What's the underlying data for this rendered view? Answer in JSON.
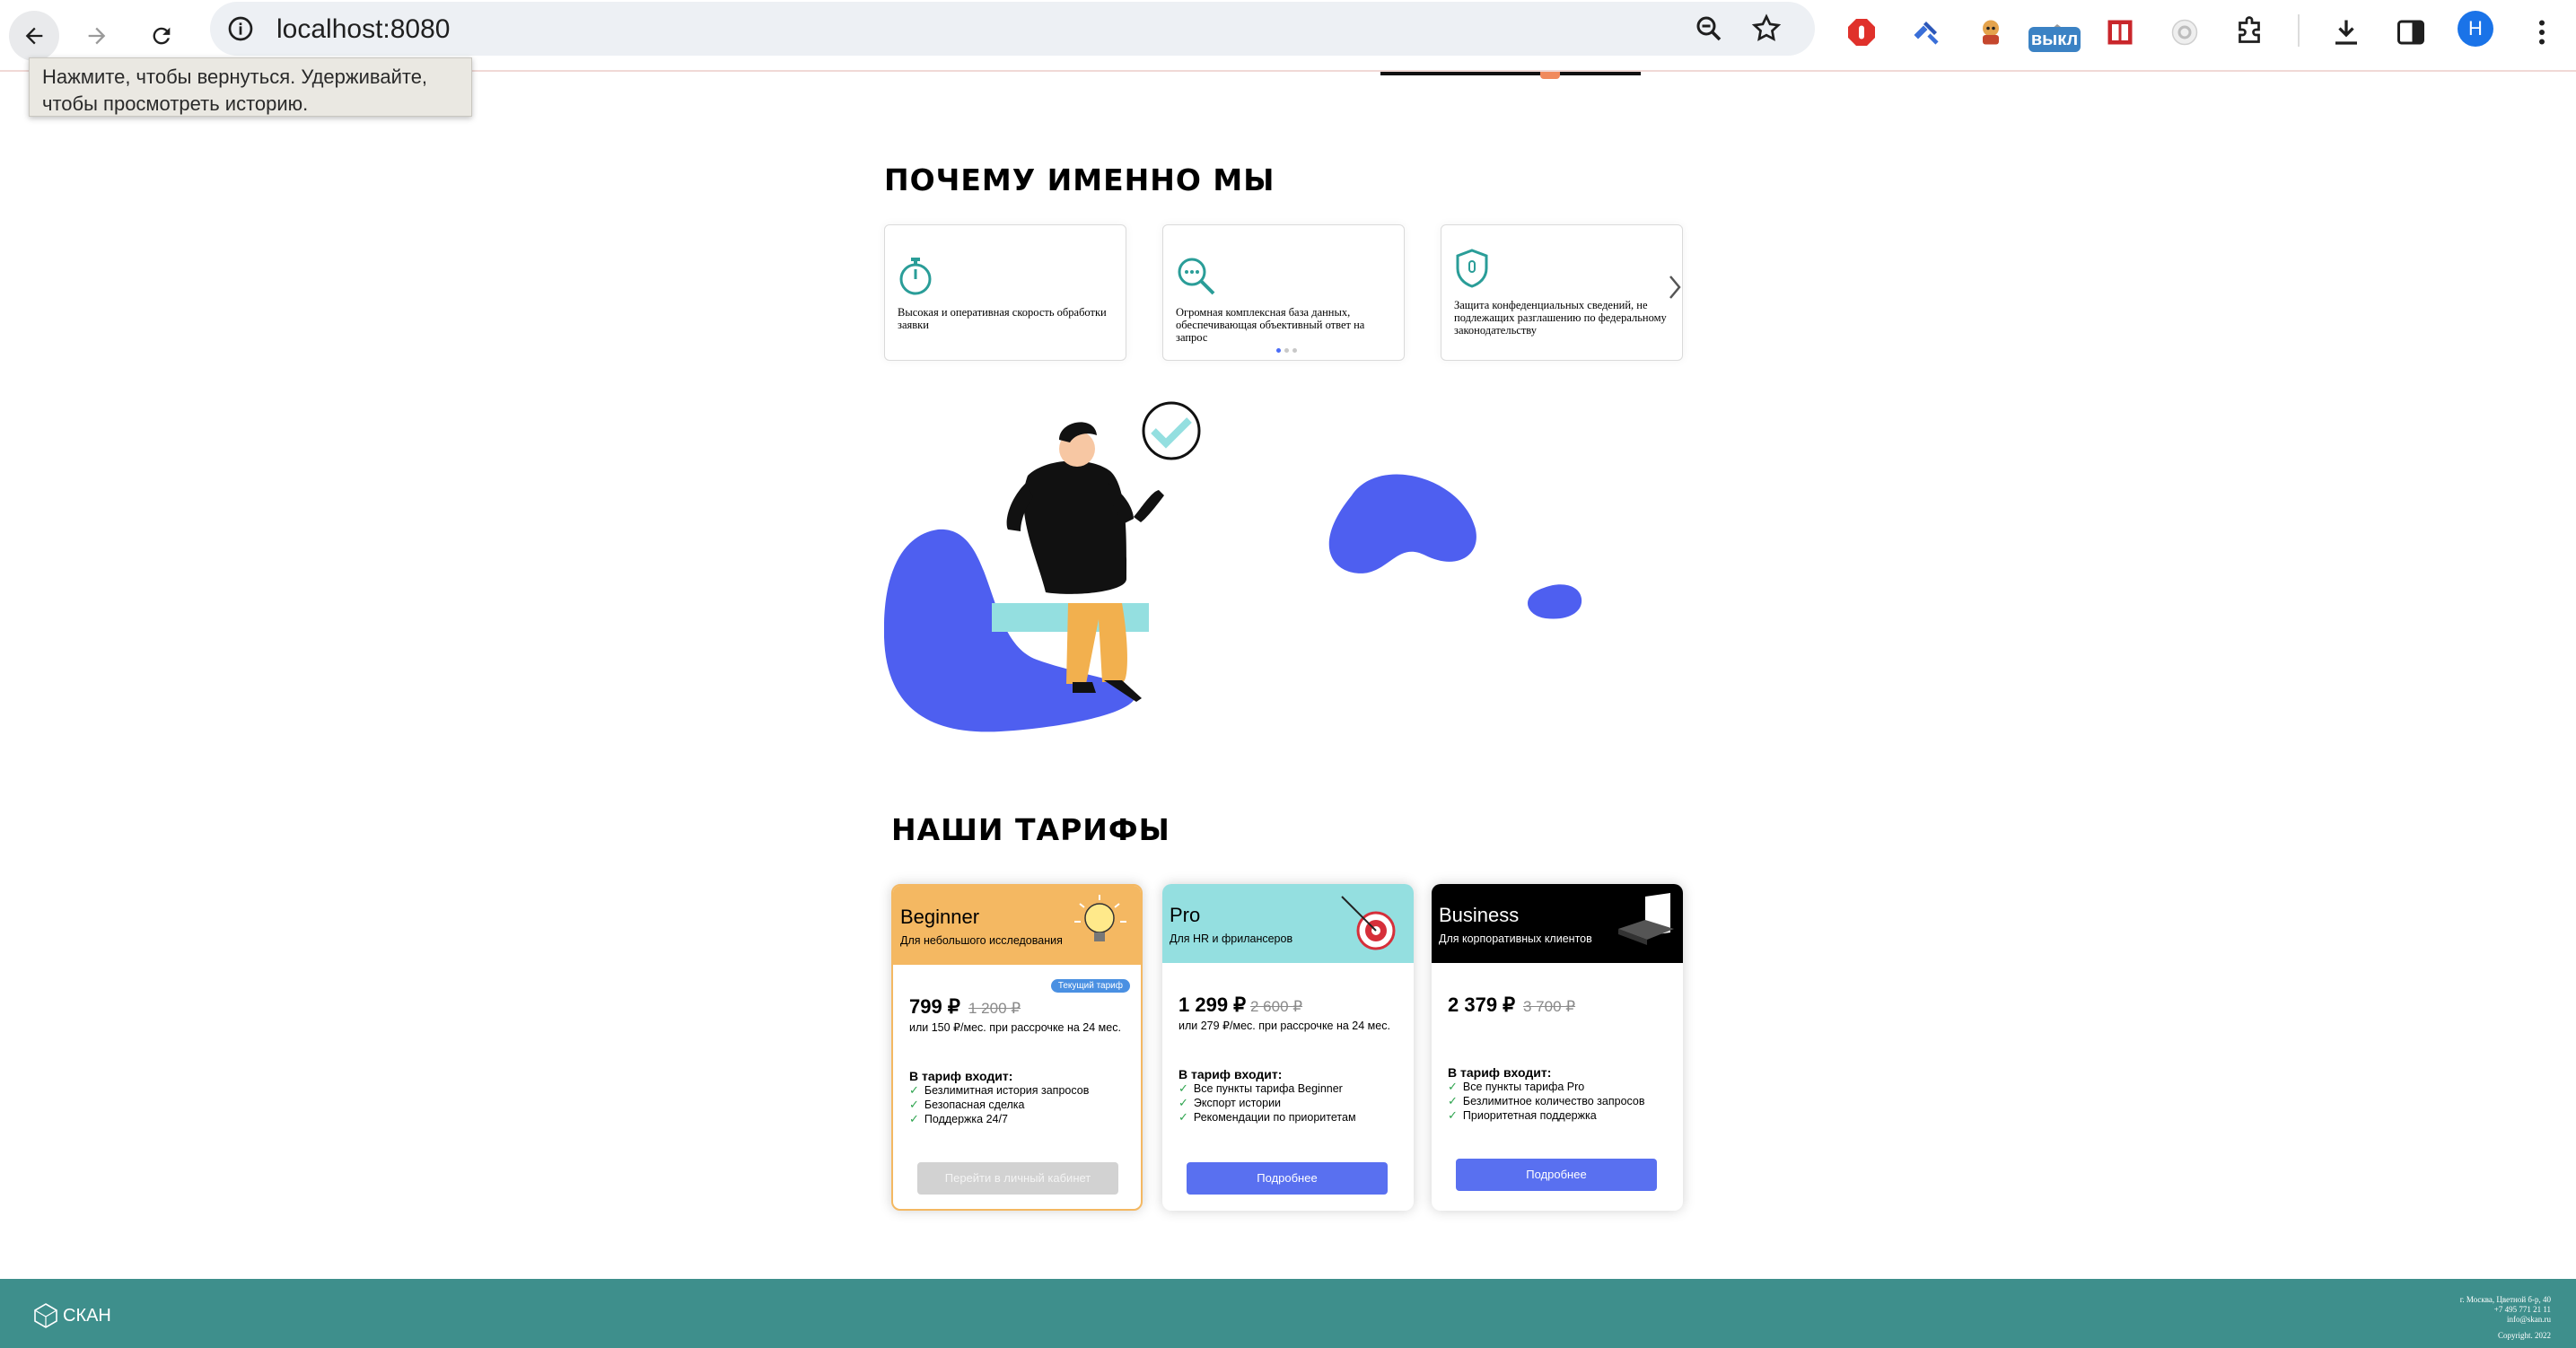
{
  "browser": {
    "url": "localhost:8080",
    "avatar_letter": "Н",
    "extension_badge": "выкл",
    "back_tooltip": "Нажмите, чтобы вернуться. Удерживайте, чтобы просмотреть историю."
  },
  "why_us": {
    "title": "ПОЧЕМУ ИМЕННО МЫ",
    "cards": [
      {
        "icon": "stopwatch-icon",
        "text": "Высокая и оперативная скорость обработки заявки"
      },
      {
        "icon": "magnifier-icon",
        "text": "Огромная комплексная база данных, обеспечивающая объективный ответ на запрос"
      },
      {
        "icon": "shield-icon",
        "text": "Защита конфеденциальных сведений, не подлежащих разглашению по федеральному законодательству"
      }
    ]
  },
  "tariffs": {
    "title": "НАШИ ТАРИФЫ",
    "plans": [
      {
        "name": "Beginner",
        "subtitle": "Для небольшого исследования",
        "color": "#f4b862",
        "badge": "Текущий тариф",
        "price": "799 ₽",
        "old_price": "1 200 ₽",
        "installment": "или 150 ₽/мес. при рассрочке на 24 мес.",
        "includes_label": "В тариф входит:",
        "features": [
          "Безлимитная история запросов",
          "Безопасная сделка",
          "Поддержка 24/7"
        ],
        "button": "Перейти в личный кабинет"
      },
      {
        "name": "Pro",
        "subtitle": "Для HR и фрилансеров",
        "color": "#94dfe0",
        "price": "1 299 ₽",
        "old_price": "2 600 ₽",
        "installment": "или 279 ₽/мес. при рассрочке на 24 мес.",
        "includes_label": "В тариф входит:",
        "features": [
          "Все пункты тарифа Beginner",
          "Экспорт истории",
          "Рекомендации по приоритетам"
        ],
        "button": "Подробнее"
      },
      {
        "name": "Business",
        "subtitle": "Для корпоративных клиентов",
        "color": "#000000",
        "price": "2 379 ₽",
        "old_price": "3 700 ₽",
        "includes_label": "В тариф входит:",
        "features": [
          "Все пункты тарифа Pro",
          "Безлимитное количество запросов",
          "Приоритетная поддержка"
        ],
        "button": "Подробнее"
      }
    ]
  },
  "footer": {
    "logo_text": "СКАН",
    "address": "г. Москва, Цветной б-р, 40",
    "phone": "+7 495 771 21 11",
    "email": "info@skan.ru",
    "copyright": "Copyright. 2022"
  },
  "colors": {
    "accent_blue": "#5970f0",
    "footer_teal": "#3e8f8c",
    "beginner_orange": "#f4b862",
    "pro_cyan": "#94dfe0",
    "business_black": "#000000"
  }
}
